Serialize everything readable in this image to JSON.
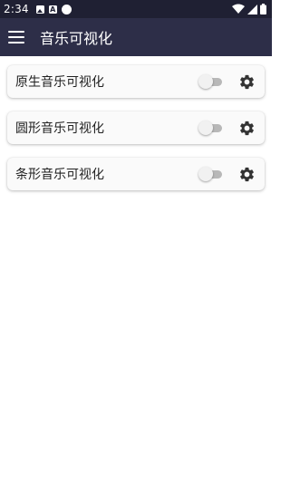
{
  "status_bar": {
    "time": "2:34",
    "left_icons": [
      "image-notification-icon",
      "a-notification-icon",
      "circle-notification-icon"
    ],
    "right_icons": [
      "wifi-icon",
      "cellular-signal-icon",
      "battery-icon"
    ]
  },
  "app_bar": {
    "menu_icon": "hamburger-menu-icon",
    "title": "音乐可视化"
  },
  "visualizers": [
    {
      "label": "原生音乐可视化",
      "enabled": false,
      "settings_icon": "gear-icon"
    },
    {
      "label": "圆形音乐可视化",
      "enabled": false,
      "settings_icon": "gear-icon"
    },
    {
      "label": "条形音乐可视化",
      "enabled": false,
      "settings_icon": "gear-icon"
    }
  ],
  "colors": {
    "status_bar": "#1f2033",
    "app_bar": "#2d2e48",
    "card_background": "#fafafa",
    "switch_track_off": "#b8b8b8",
    "switch_thumb_off": "#f1f1f1",
    "icon": "#333333"
  }
}
